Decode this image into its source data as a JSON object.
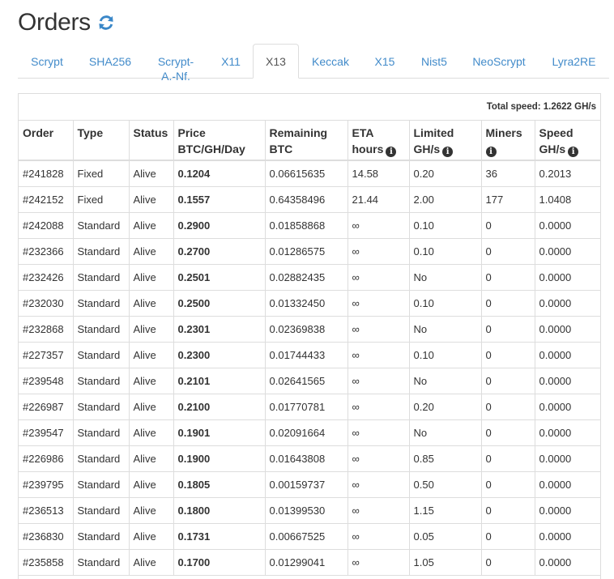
{
  "page": {
    "title": "Orders",
    "refresh_icon": "refresh-icon"
  },
  "tabs": [
    {
      "label": "Scrypt",
      "active": false
    },
    {
      "label": "SHA256",
      "active": false
    },
    {
      "label": "Scrypt-A.-Nf.",
      "line1": "Scrypt-",
      "line2": "A.-Nf.",
      "active": false
    },
    {
      "label": "X11",
      "active": false
    },
    {
      "label": "X13",
      "active": true
    },
    {
      "label": "Keccak",
      "active": false
    },
    {
      "label": "X15",
      "active": false
    },
    {
      "label": "Nist5",
      "active": false
    },
    {
      "label": "NeoScrypt",
      "active": false
    },
    {
      "label": "Lyra2RE",
      "active": false
    }
  ],
  "summary": {
    "total_speed": "Total speed: 1.2622 GH/s"
  },
  "table": {
    "headers": [
      {
        "line1": "Order",
        "line2": ""
      },
      {
        "line1": "Type",
        "line2": ""
      },
      {
        "line1": "Status",
        "line2": ""
      },
      {
        "line1": "Price",
        "line2": "BTC/GH/Day"
      },
      {
        "line1": "Remaining",
        "line2": "BTC"
      },
      {
        "line1": "ETA",
        "line2": "hours"
      },
      {
        "line1": "Limited",
        "line2": "GH/s"
      },
      {
        "line1": "Miners",
        "line2": ""
      },
      {
        "line1": "Speed",
        "line2": "GH/s"
      }
    ],
    "rows": [
      [
        "#241828",
        "Fixed",
        "Alive",
        "0.1204",
        "0.06615635",
        "14.58",
        "0.20",
        "36",
        "0.2013"
      ],
      [
        "#242152",
        "Fixed",
        "Alive",
        "0.1557",
        "0.64358496",
        "21.44",
        "2.00",
        "177",
        "1.0408"
      ],
      [
        "#242088",
        "Standard",
        "Alive",
        "0.2900",
        "0.01858868",
        "∞",
        "0.10",
        "0",
        "0.0000"
      ],
      [
        "#232366",
        "Standard",
        "Alive",
        "0.2700",
        "0.01286575",
        "∞",
        "0.10",
        "0",
        "0.0000"
      ],
      [
        "#232426",
        "Standard",
        "Alive",
        "0.2501",
        "0.02882435",
        "∞",
        "No",
        "0",
        "0.0000"
      ],
      [
        "#232030",
        "Standard",
        "Alive",
        "0.2500",
        "0.01332450",
        "∞",
        "0.10",
        "0",
        "0.0000"
      ],
      [
        "#232868",
        "Standard",
        "Alive",
        "0.2301",
        "0.02369838",
        "∞",
        "No",
        "0",
        "0.0000"
      ],
      [
        "#227357",
        "Standard",
        "Alive",
        "0.2300",
        "0.01744433",
        "∞",
        "0.10",
        "0",
        "0.0000"
      ],
      [
        "#239548",
        "Standard",
        "Alive",
        "0.2101",
        "0.02641565",
        "∞",
        "No",
        "0",
        "0.0000"
      ],
      [
        "#226987",
        "Standard",
        "Alive",
        "0.2100",
        "0.01770781",
        "∞",
        "0.20",
        "0",
        "0.0000"
      ],
      [
        "#239547",
        "Standard",
        "Alive",
        "0.1901",
        "0.02091664",
        "∞",
        "No",
        "0",
        "0.0000"
      ],
      [
        "#226986",
        "Standard",
        "Alive",
        "0.1900",
        "0.01643808",
        "∞",
        "0.85",
        "0",
        "0.0000"
      ],
      [
        "#239795",
        "Standard",
        "Alive",
        "0.1805",
        "0.00159737",
        "∞",
        "0.50",
        "0",
        "0.0000"
      ],
      [
        "#236513",
        "Standard",
        "Alive",
        "0.1800",
        "0.01399530",
        "∞",
        "1.15",
        "0",
        "0.0000"
      ],
      [
        "#236830",
        "Standard",
        "Alive",
        "0.1731",
        "0.00667525",
        "∞",
        "0.05",
        "0",
        "0.0000"
      ],
      [
        "#235858",
        "Standard",
        "Alive",
        "0.1700",
        "0.01299041",
        "∞",
        "1.05",
        "0",
        "0.0000"
      ]
    ]
  },
  "colors": {
    "link": "#428bca",
    "text": "#333333",
    "border": "#dddddd",
    "refresh": "#3a87c8"
  },
  "icons": {
    "info": "info-circle-icon"
  }
}
